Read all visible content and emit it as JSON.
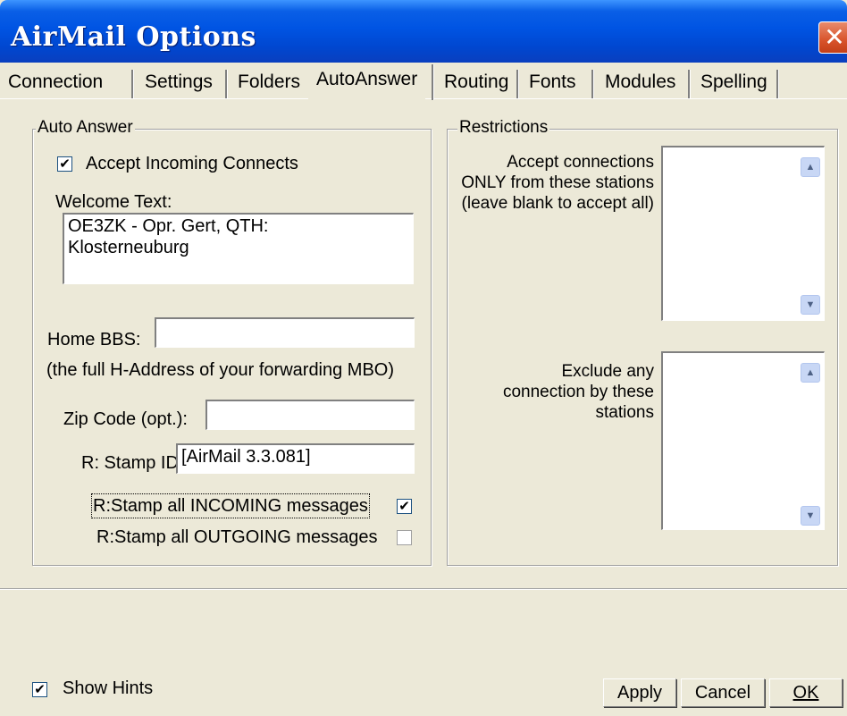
{
  "window": {
    "title": "AirMail Options",
    "close_glyph": "✕"
  },
  "tabs": [
    {
      "label": "Connection"
    },
    {
      "label": "Settings"
    },
    {
      "label": "Folders"
    },
    {
      "label": "AutoAnswer",
      "active": true
    },
    {
      "label": "Routing"
    },
    {
      "label": "Fonts"
    },
    {
      "label": "Modules"
    },
    {
      "label": "Spelling"
    }
  ],
  "auto_answer": {
    "group_label": "Auto Answer",
    "accept_incoming_label": "Accept Incoming Connects",
    "accept_incoming_checked": true,
    "welcome_text_label": "Welcome Text:",
    "welcome_text_value": "OE3ZK - Opr. Gert, QTH:\nKlosterneuburg",
    "home_bbs_label": "Home BBS:",
    "home_bbs_value": "",
    "home_bbs_hint": "(the full H-Address of your forwarding MBO)",
    "zip_label": "Zip Code (opt.):",
    "zip_value": "",
    "stamp_id_label": "R: Stamp ID:",
    "stamp_id_value": "[AirMail 3.3.081]",
    "stamp_incoming_label": "R:Stamp all INCOMING messages",
    "stamp_incoming_checked": true,
    "stamp_outgoing_label": "R:Stamp all OUTGOING messages",
    "stamp_outgoing_checked": false,
    "check_glyph": "✔"
  },
  "restrictions": {
    "group_label": "Restrictions",
    "accept_only_label": "Accept connections ONLY from these stations (leave blank to accept all)",
    "accept_only_value": "",
    "exclude_label": "Exclude any connection by these stations",
    "exclude_value": ""
  },
  "footer": {
    "show_hints_label": "Show Hints",
    "show_hints_checked": true,
    "apply_label": "Apply",
    "cancel_label": "Cancel",
    "ok_label": "OK"
  },
  "colors": {
    "titlebar": "#0054e3",
    "dialog_bg": "#ece9d8",
    "close_button": "#d8532b"
  }
}
